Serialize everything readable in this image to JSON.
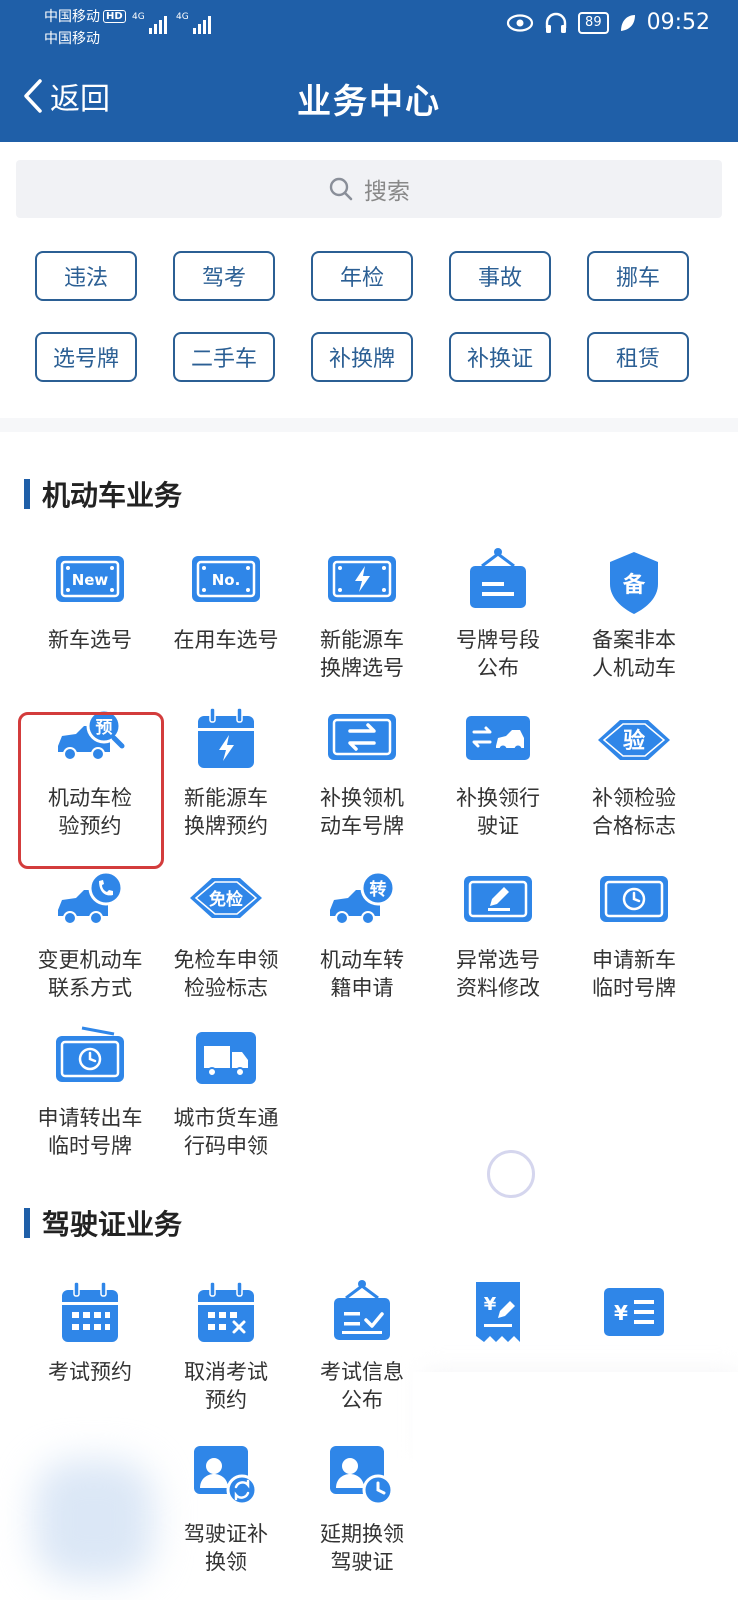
{
  "status_bar": {
    "carrier_1": "中国移动",
    "carrier_1_badge": "HD",
    "carrier_2": "中国移动",
    "network_1": "4G",
    "network_2": "4G",
    "battery": "89",
    "time": "09:52"
  },
  "nav": {
    "back_label": "返回",
    "title": "业务中心"
  },
  "search": {
    "placeholder": "搜索"
  },
  "tags": [
    "违法",
    "驾考",
    "年检",
    "事故",
    "挪车",
    "选号牌",
    "二手车",
    "补换牌",
    "补换证",
    "租赁"
  ],
  "sections": [
    {
      "title": "机动车业务",
      "items": [
        {
          "label": "新车选号",
          "icon": "new-plate-icon"
        },
        {
          "label": "在用车选号",
          "icon": "no-plate-icon"
        },
        {
          "label": "新能源车\n换牌选号",
          "icon": "ev-plate-icon"
        },
        {
          "label": "号牌号段\n公布",
          "icon": "notice-board-icon"
        },
        {
          "label": "备案非本\n人机动车",
          "icon": "record-shield-icon"
        },
        {
          "label": "机动车检\n验预约",
          "icon": "inspection-booking-icon"
        },
        {
          "label": "新能源车\n换牌预约",
          "icon": "ev-calendar-icon"
        },
        {
          "label": "补换领机\n动车号牌",
          "icon": "plate-exchange-icon"
        },
        {
          "label": "补换领行\n驶证",
          "icon": "license-exchange-icon"
        },
        {
          "label": "补领检验\n合格标志",
          "icon": "inspection-mark-icon"
        },
        {
          "label": "变更机动车\n联系方式",
          "icon": "truck-phone-icon"
        },
        {
          "label": "免检车申领\n检验标志",
          "icon": "exempt-badge-icon"
        },
        {
          "label": "机动车转\n籍申请",
          "icon": "truck-transfer-icon"
        },
        {
          "label": "异常选号\n资料修改",
          "icon": "edit-plate-icon"
        },
        {
          "label": "申请新车\n临时号牌",
          "icon": "temp-plate-icon"
        },
        {
          "label": "申请转出车\n临时号牌",
          "icon": "temp-plate-out-icon"
        },
        {
          "label": "城市货车通\n行码申领",
          "icon": "truck-pass-icon"
        }
      ]
    },
    {
      "title": "驾驶证业务",
      "items": [
        {
          "label": "考试预约",
          "icon": "exam-calendar-icon"
        },
        {
          "label": "取消考试\n预约",
          "icon": "cancel-calendar-icon"
        },
        {
          "label": "考试信息\n公布",
          "icon": "exam-notice-icon"
        },
        {
          "label": "",
          "icon": "fee-edit-icon"
        },
        {
          "label": "",
          "icon": "fee-list-icon"
        },
        {
          "label": "",
          "icon": "blurred-icon"
        },
        {
          "label": "驾驶证补\n换领",
          "icon": "license-reissue-icon"
        },
        {
          "label": "延期换领\n驾驶证",
          "icon": "license-delay-icon"
        }
      ]
    }
  ],
  "colors": {
    "primary": "#1f5fa8",
    "icon_blue": "#2f86e8",
    "tag_border": "#2b5f94",
    "highlight": "#d33c3c"
  }
}
